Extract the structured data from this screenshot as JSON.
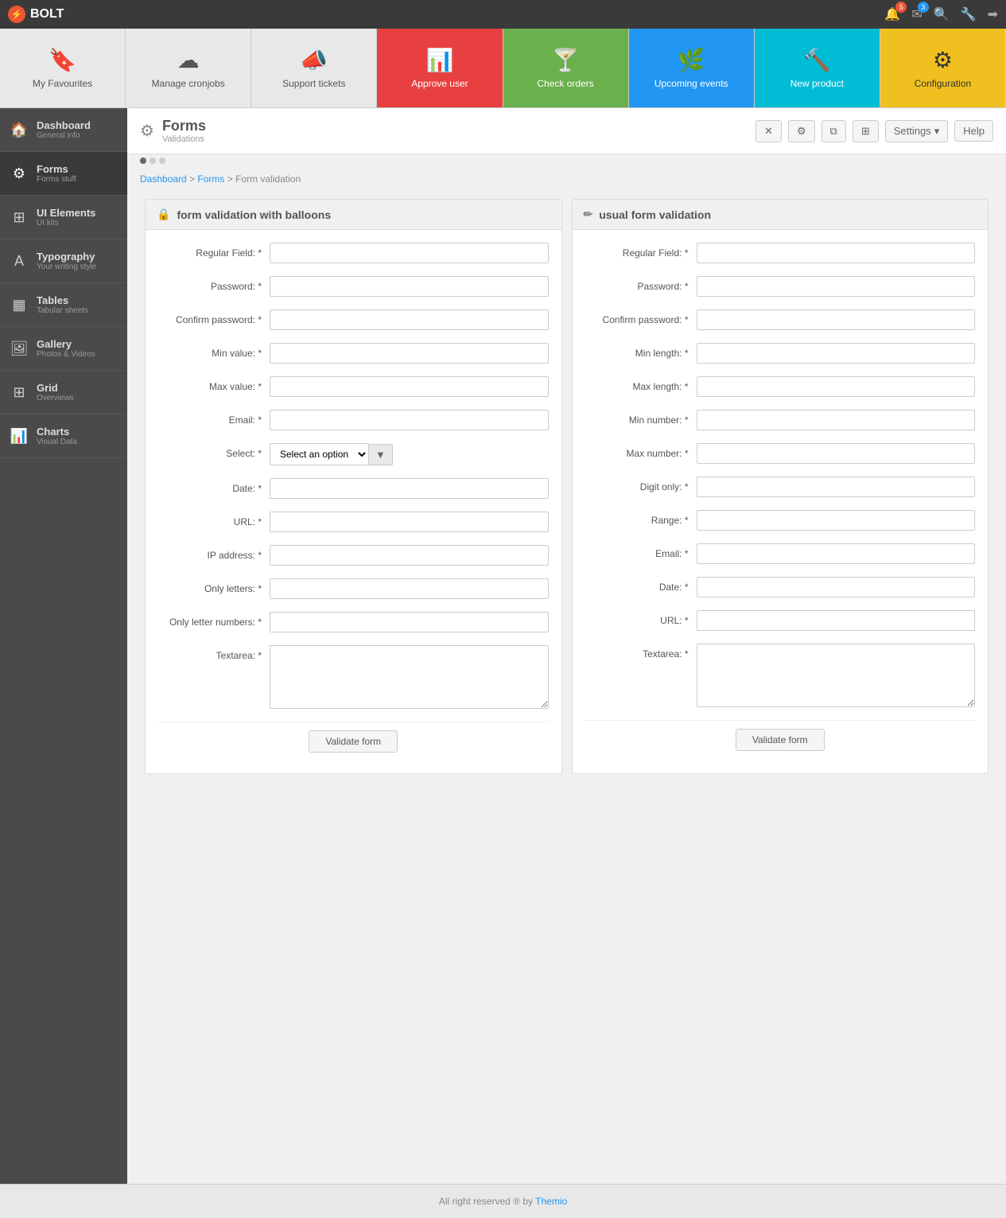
{
  "app": {
    "title": "BOLT"
  },
  "topbar": {
    "notifications_count": "5",
    "messages_count": "3"
  },
  "quickbar": {
    "items": [
      {
        "id": "my-favourites",
        "label": "My Favourites",
        "icon": "🔖",
        "style": "default"
      },
      {
        "id": "manage-cronjobs",
        "label": "Manage cronjobs",
        "icon": "☁",
        "style": "default"
      },
      {
        "id": "support-tickets",
        "label": "Support tickets",
        "icon": "📣",
        "style": "default"
      },
      {
        "id": "approve-user",
        "label": "Approve user",
        "icon": "📊",
        "style": "active-red"
      },
      {
        "id": "check-orders",
        "label": "Check orders",
        "icon": "🍸",
        "style": "active-green"
      },
      {
        "id": "upcoming-events",
        "label": "Upcoming events",
        "icon": "🌿",
        "style": "active-blue"
      },
      {
        "id": "new-product",
        "label": "New product",
        "icon": "🔨",
        "style": "active-teal"
      },
      {
        "id": "configuration",
        "label": "Configuration",
        "icon": "⚙",
        "style": "active-yellow"
      }
    ]
  },
  "sidebar": {
    "items": [
      {
        "id": "dashboard",
        "title": "Dashboard",
        "subtitle": "General info",
        "icon": "🏠",
        "active": false
      },
      {
        "id": "forms",
        "title": "Forms",
        "subtitle": "Forms stuff",
        "icon": "⚙",
        "active": true
      },
      {
        "id": "ui-elements",
        "title": "UI Elements",
        "subtitle": "UI kits",
        "icon": "⊞",
        "active": false
      },
      {
        "id": "typography",
        "title": "Typography",
        "subtitle": "Your writing style",
        "icon": "A",
        "active": false
      },
      {
        "id": "tables",
        "title": "Tables",
        "subtitle": "Tabular sheets",
        "icon": "▦",
        "active": false
      },
      {
        "id": "gallery",
        "title": "Gallery",
        "subtitle": "Photos & Videos",
        "icon": "🖼",
        "active": false
      },
      {
        "id": "grid",
        "title": "Grid",
        "subtitle": "Overviews",
        "icon": "⊞",
        "active": false
      },
      {
        "id": "charts",
        "title": "Charts",
        "subtitle": "Visual Data",
        "icon": "📊",
        "active": false
      }
    ]
  },
  "content": {
    "page_icon": "⚙",
    "page_title": "Forms",
    "page_subtitle": "Validations",
    "settings_label": "Settings",
    "help_label": "Help",
    "breadcrumb": {
      "dashboard": "Dashboard",
      "forms": "Forms",
      "current": "Form validation"
    }
  },
  "form_balloon": {
    "title": "form validation with balloons",
    "icon": "🔒",
    "fields": [
      {
        "id": "regular-field-1",
        "label": "Regular Field: *",
        "type": "text"
      },
      {
        "id": "password-1",
        "label": "Password: *",
        "type": "password"
      },
      {
        "id": "confirm-password-1",
        "label": "Confirm password: *",
        "type": "password"
      },
      {
        "id": "min-value",
        "label": "Min value: *",
        "type": "text"
      },
      {
        "id": "max-value",
        "label": "Max value: *",
        "type": "text"
      },
      {
        "id": "email-1",
        "label": "Email: *",
        "type": "text"
      }
    ],
    "select_label": "Select: *",
    "select_placeholder": "Select an option",
    "select_arrow": "▼",
    "late_fields": [
      {
        "id": "date-1",
        "label": "Date: *",
        "type": "text"
      },
      {
        "id": "url-1",
        "label": "URL: *",
        "type": "text"
      },
      {
        "id": "ip-address",
        "label": "IP address: *",
        "type": "text"
      },
      {
        "id": "only-letters",
        "label": "Only letters: *",
        "type": "text"
      },
      {
        "id": "only-letter-numbers",
        "label": "Only letter numbers: *",
        "type": "text"
      }
    ],
    "textarea_label": "Textarea: *",
    "validate_btn": "Validate form"
  },
  "form_usual": {
    "title": "usual form validation",
    "icon": "✏",
    "fields": [
      {
        "id": "regular-field-2",
        "label": "Regular Field: *",
        "type": "text"
      },
      {
        "id": "password-2",
        "label": "Password: *",
        "type": "password"
      },
      {
        "id": "confirm-password-2",
        "label": "Confirm password: *",
        "type": "password"
      },
      {
        "id": "min-length",
        "label": "Min length: *",
        "type": "text"
      },
      {
        "id": "max-length",
        "label": "Max length: *",
        "type": "text"
      },
      {
        "id": "min-number",
        "label": "Min number: *",
        "type": "text"
      },
      {
        "id": "max-number",
        "label": "Max number: *",
        "type": "text"
      },
      {
        "id": "digit-only",
        "label": "Digit only: *",
        "type": "text"
      },
      {
        "id": "range",
        "label": "Range: *",
        "type": "text"
      },
      {
        "id": "email-2",
        "label": "Email: *",
        "type": "text"
      },
      {
        "id": "date-2",
        "label": "Date: *",
        "type": "text"
      },
      {
        "id": "url-2",
        "label": "URL: *",
        "type": "text"
      }
    ],
    "textarea_label": "Textarea: *",
    "validate_btn": "Validate form"
  },
  "footer": {
    "text": "All right reserved ® by ",
    "link_text": "Themio",
    "link_url": "#"
  }
}
